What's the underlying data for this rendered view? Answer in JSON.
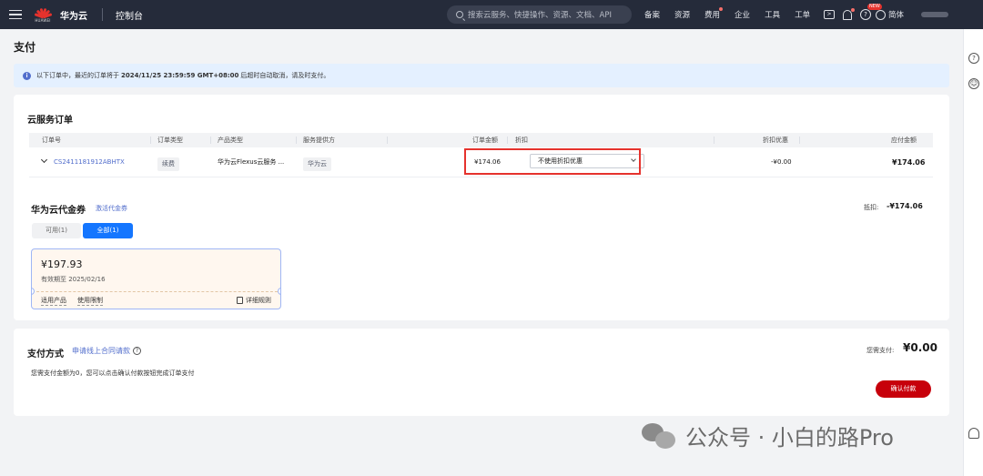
{
  "header": {
    "logo_text": "HUAWEI",
    "brand": "华为云",
    "console": "控制台",
    "search_placeholder": "搜索云服务、快捷操作、资源、文档、API",
    "nav": [
      "备案",
      "资源",
      "费用",
      "企业",
      "工具",
      "工单"
    ],
    "badge_new": "NEW",
    "lang": "简体"
  },
  "page": {
    "title": "支付",
    "notice_prefix": "以下订单中，最近的订单将于",
    "notice_time": "2024/11/25 23:59:59 GMT+08:00",
    "notice_suffix": "后超时自动取消，请及时支付。"
  },
  "orders": {
    "title": "云服务订单",
    "columns": [
      "订单号",
      "订单类型",
      "产品类型",
      "服务提供方",
      "订单金额",
      "折扣",
      "折扣优惠",
      "应付金额"
    ],
    "rows": [
      {
        "order_no": "CS2411181912ABHTX",
        "type": "续费",
        "product": "华为云Flexus云服务 ...",
        "provider": "华为云",
        "amount": "¥174.06",
        "discount_select": "不使用折扣优惠",
        "discount_off": "-¥0.00",
        "payable": "¥174.06"
      }
    ]
  },
  "coupons": {
    "title": "华为云代金券",
    "activate": "激活代金券",
    "deduct_label": "抵扣:",
    "deduct_value": "-¥174.06",
    "tabs": [
      "可用(1)",
      "全部(1)"
    ],
    "items": [
      {
        "amount": "¥197.93",
        "expiry": "有效期至 2025/02/16",
        "link1": "适用产品",
        "link2": "使用限制",
        "rule": "详细规则"
      }
    ]
  },
  "payment": {
    "title": "支付方式",
    "contract_link": "申请线上合同请款",
    "need_label": "您需支付:",
    "need_value": "¥0.00",
    "desc": "您需支付金额为0，您可以点击确认付款按钮完成订单支付",
    "confirm": "确认付款"
  },
  "watermark": "公众号 · 小白的路Pro"
}
